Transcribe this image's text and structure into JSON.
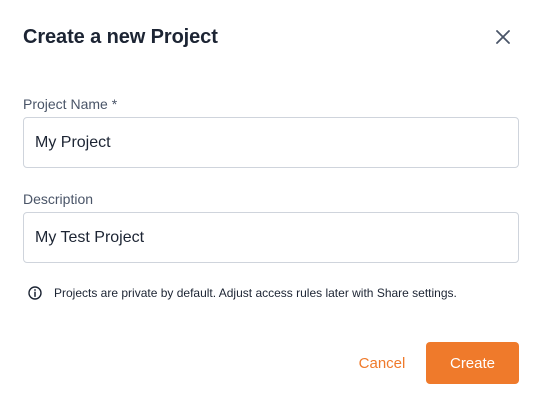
{
  "dialog": {
    "title": "Create a new Project",
    "close_icon": "close-icon"
  },
  "form": {
    "project_name": {
      "label": "Project Name *",
      "value": "My Project"
    },
    "description": {
      "label": "Description",
      "value": "My Test Project"
    }
  },
  "info": {
    "icon": "info-icon",
    "text": "Projects are private by default. Adjust access rules later with Share settings."
  },
  "actions": {
    "cancel_label": "Cancel",
    "create_label": "Create"
  },
  "colors": {
    "accent": "#ef7a2b",
    "title_text": "#1c2433",
    "label_text": "#4a5568",
    "input_border": "#cfd4dc"
  }
}
